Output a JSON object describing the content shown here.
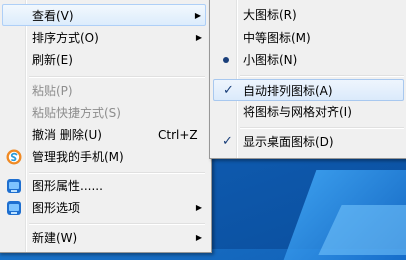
{
  "context_menu": {
    "items": [
      {
        "label": "查看(V)"
      },
      {
        "label": "排序方式(O)"
      },
      {
        "label": "刷新(E)"
      },
      {
        "label": "粘贴(P)"
      },
      {
        "label": "粘贴快捷方式(S)"
      },
      {
        "label": "撤消 删除(U)",
        "accel": "Ctrl+Z"
      },
      {
        "label": "管理我的手机(M)"
      },
      {
        "label": "图形属性......"
      },
      {
        "label": "图形选项"
      },
      {
        "label": "新建(W)"
      }
    ]
  },
  "view_submenu": {
    "items": [
      {
        "label": "大图标(R)"
      },
      {
        "label": "中等图标(M)"
      },
      {
        "label": "小图标(N)",
        "selected": true
      },
      {
        "label": "自动排列图标(A)",
        "checked": true
      },
      {
        "label": "将图标与网格对齐(I)"
      },
      {
        "label": "显示桌面图标(D)",
        "checked": true
      }
    ]
  },
  "glyphs": {
    "arrow": "▶",
    "check": "✓"
  },
  "colors": {
    "highlight": "#dcecfc",
    "desktop": "#0f5db3",
    "menu_bg": "#f0f0f0",
    "phone_icon": "#f08a24",
    "graphics_icon": "#1e6fd0"
  }
}
